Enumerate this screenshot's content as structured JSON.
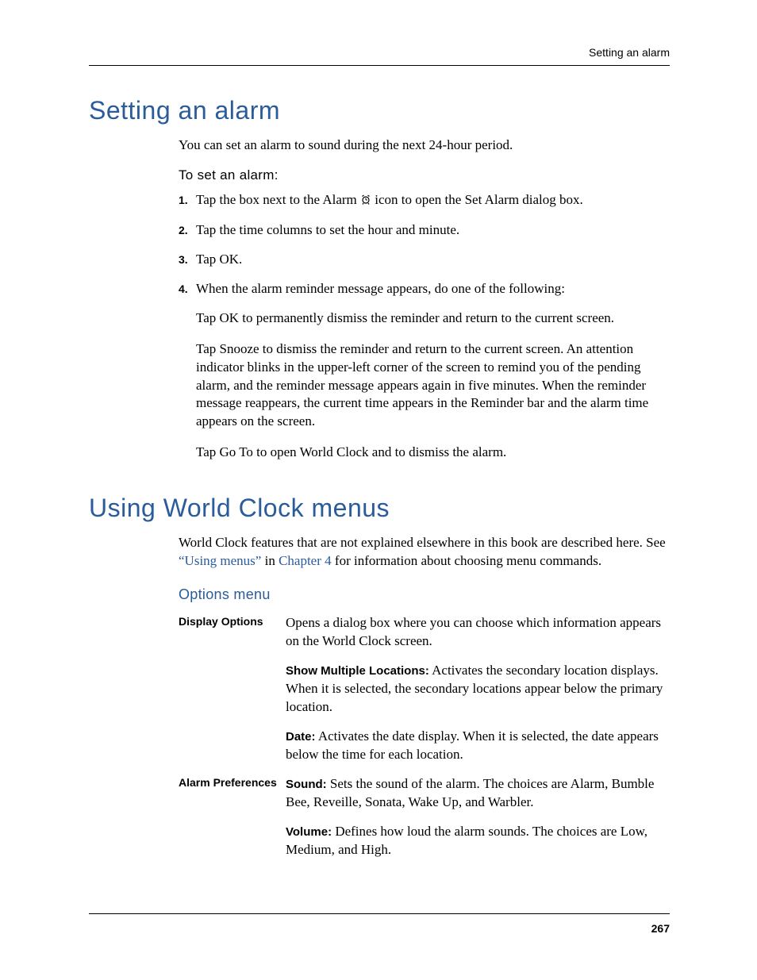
{
  "header": {
    "running_title": "Setting an alarm"
  },
  "section1": {
    "title": "Setting an alarm",
    "intro": "You can set an alarm to sound during the next 24-hour period.",
    "subhead": "To set an alarm:",
    "steps": {
      "1": {
        "num": "1.",
        "text_a": "Tap the box next to the Alarm ",
        "text_b": " icon to open the Set Alarm dialog box."
      },
      "2": {
        "num": "2.",
        "text": "Tap the time columns to set the hour and minute."
      },
      "3": {
        "num": "3.",
        "text": "Tap OK."
      },
      "4": {
        "num": "4.",
        "text": "When the alarm reminder message appears, do one of the following:"
      }
    },
    "subparas": {
      "a": "Tap OK to permanently dismiss the reminder and return to the current screen.",
      "b": "Tap Snooze to dismiss the reminder and return to the current screen. An attention indicator blinks in the upper-left corner of the screen to remind you of the pending alarm, and the reminder message appears again in five minutes. When the reminder message reappears, the current time appears in the Reminder bar and the alarm time appears on the screen.",
      "c": "Tap Go To to open World Clock and to dismiss the alarm."
    }
  },
  "section2": {
    "title": "Using World Clock menus",
    "intro_a": "World Clock features that are not explained elsewhere in this book are described here. See ",
    "link1": "“Using menus”",
    "intro_b": " in ",
    "link2": "Chapter 4",
    "intro_c": " for information about choosing menu commands.",
    "options_heading": "Options menu",
    "display_options": {
      "label": "Display Options",
      "entry1": "Opens a dialog box where you can choose which information appears on the World Clock screen.",
      "entry2_bold": "Show Multiple Locations:",
      "entry2_rest": " Activates the secondary location displays. When it is selected, the secondary locations appear below the primary location.",
      "entry3_bold": "Date:",
      "entry3_rest": " Activates the date display. When it is selected, the date appears below the time for each location."
    },
    "alarm_prefs": {
      "label": "Alarm Preferences",
      "entry1_bold": "Sound:",
      "entry1_rest": " Sets the sound of the alarm. The choices are Alarm, Bumble Bee, Reveille, Sonata, Wake Up, and Warbler.",
      "entry2_bold": "Volume:",
      "entry2_rest": " Defines how loud the alarm sounds. The choices are Low, Medium, and High."
    }
  },
  "footer": {
    "page_number": "267"
  }
}
